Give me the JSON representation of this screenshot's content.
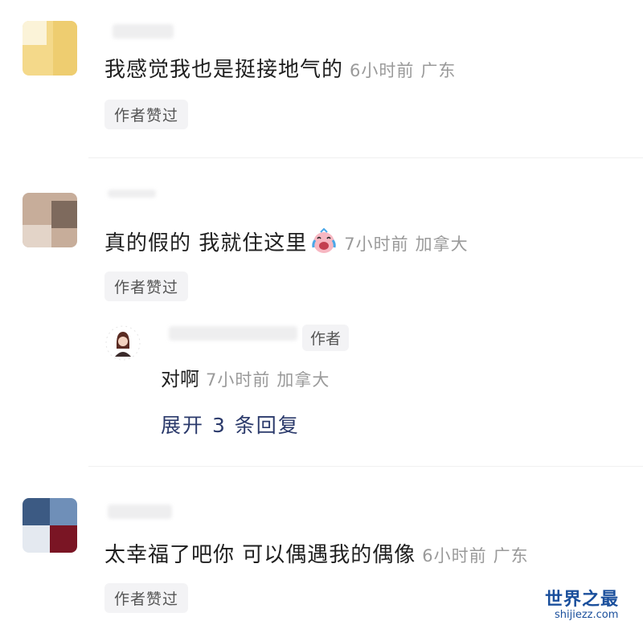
{
  "comments": [
    {
      "text": "我感觉我也是挺接地气的",
      "time": "6小时前",
      "location": "广东",
      "liked_label": "作者赞过",
      "avatar_colors": [
        "#f4d98a",
        "#eecd70",
        "#f7e3a6"
      ]
    },
    {
      "text": "真的假的 我就住这里",
      "time": "7小时前",
      "location": "加拿大",
      "liked_label": "作者赞过",
      "emoji": "crying-laughing-emoji",
      "avatar_colors": [
        "#b69a86",
        "#8a7566",
        "#d8c6b8"
      ],
      "reply": {
        "author_tag": "作者",
        "text": "对啊",
        "time": "7小时前",
        "location": "加拿大"
      },
      "expand_label": "展开 3 条回复"
    },
    {
      "text": "太幸福了吧你 可以偶遇我的偶像",
      "time": "6小时前",
      "location": "广东",
      "liked_label": "作者赞过",
      "avatar_colors": [
        "#3c5a83",
        "#6f8fb8",
        "#e4e9f0",
        "#7a1524"
      ]
    }
  ],
  "watermark": {
    "title": "世界之最",
    "url": "shijiezz.com"
  }
}
